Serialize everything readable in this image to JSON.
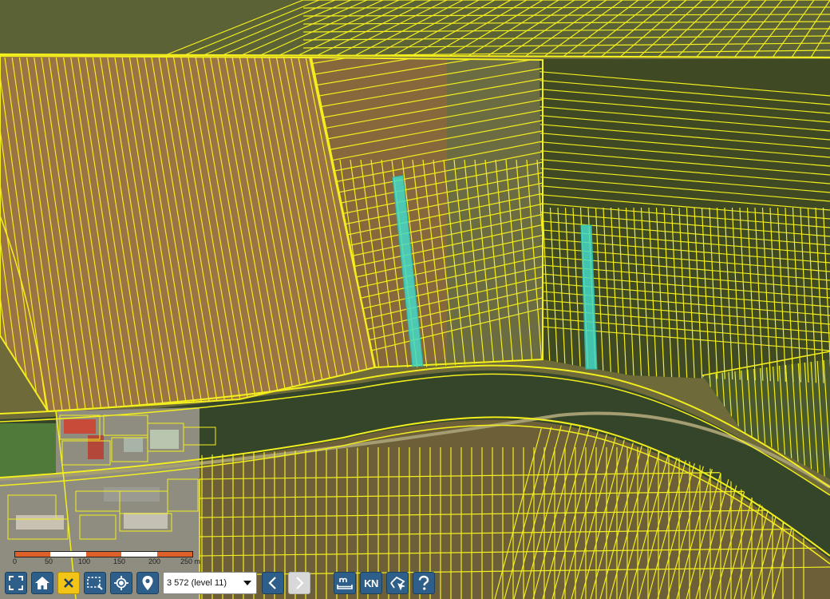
{
  "map": {
    "highlight_color": "#43d9c8",
    "parcel_line_color": "#f3ee1e"
  },
  "scalebar": {
    "labels": [
      "0",
      "50",
      "100",
      "150",
      "200",
      "250 m"
    ],
    "colors": [
      "#e0602a",
      "#ffffff",
      "#e0602a",
      "#ffffff",
      "#e0602a"
    ]
  },
  "toolbar": {
    "buttons": [
      {
        "icon": "fullscreen-icon"
      },
      {
        "icon": "home-icon"
      },
      {
        "icon": "close-icon",
        "active": true
      },
      {
        "icon": "select-area-icon"
      },
      {
        "icon": "locate-icon"
      },
      {
        "icon": "map-marker-icon"
      }
    ],
    "zoom_select": {
      "value": "3 572 (level 11)"
    },
    "nav": [
      {
        "icon": "chevron-left-icon"
      },
      {
        "icon": "chevron-right-icon",
        "disabled": true
      }
    ],
    "tools": [
      {
        "icon": "measure-icon"
      },
      {
        "label": "KN"
      },
      {
        "icon": "polygon-icon"
      },
      {
        "icon": "help-icon"
      }
    ]
  }
}
